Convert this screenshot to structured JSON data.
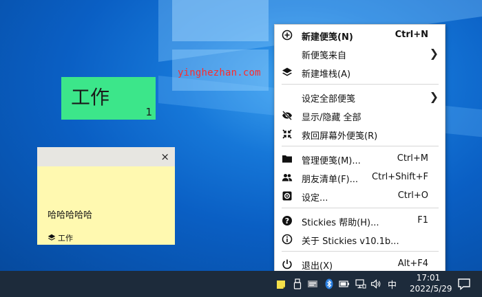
{
  "watermark": "yinghezhan.com",
  "desktop": {
    "stack_note": {
      "title": "工作",
      "count": "1",
      "color": "#3ce68a"
    },
    "sticky_note": {
      "text": "哈哈哈哈哈",
      "stack_label": "工作",
      "close_glyph": "×",
      "color": "#fff9b0"
    }
  },
  "menu": {
    "items": [
      {
        "icon": "plus-circle-icon",
        "label": "新建便笺(N)",
        "shortcut": "Ctrl+N",
        "bold": true
      },
      {
        "icon": "",
        "label": "新便笺来自",
        "shortcut": "",
        "submenu": true
      },
      {
        "icon": "layers-icon",
        "label": "新建堆栈(A)",
        "shortcut": ""
      },
      {
        "icon": "",
        "label": "设定全部便笺",
        "shortcut": "",
        "submenu": true
      },
      {
        "icon": "eye-off-icon",
        "label": "显示/隐藏 全部",
        "shortcut": ""
      },
      {
        "icon": "collapse-icon",
        "label": "救回屏幕外便笺(R)",
        "shortcut": ""
      },
      {
        "icon": "folder-icon",
        "label": "管理便笺(M)...",
        "shortcut": "Ctrl+M"
      },
      {
        "icon": "users-icon",
        "label": "朋友清单(F)...",
        "shortcut": "Ctrl+Shift+F"
      },
      {
        "icon": "gear-icon",
        "label": "设定...",
        "shortcut": "Ctrl+O"
      },
      {
        "icon": "help-icon",
        "label": "Stickies 帮助(H)...",
        "shortcut": "F1"
      },
      {
        "icon": "info-icon",
        "label": "关于 Stickies v10.1b...",
        "shortcut": ""
      },
      {
        "icon": "power-icon",
        "label": "退出(X)",
        "shortcut": "Alt+F4"
      }
    ]
  },
  "taskbar": {
    "time": "17:01",
    "date": "2022/5/29",
    "ime": "中",
    "tray_icons": [
      "stickies-icon",
      "usb-icon",
      "vm-icon",
      "bluetooth-icon",
      "battery-icon",
      "network-icon",
      "volume-icon"
    ]
  }
}
